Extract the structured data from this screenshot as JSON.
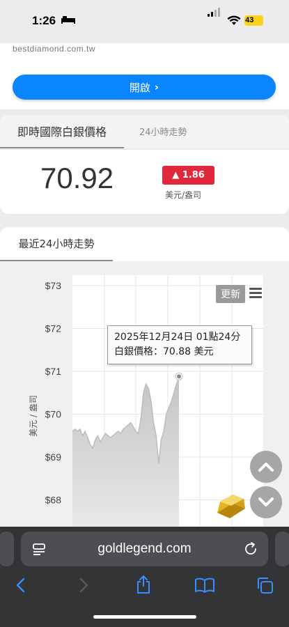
{
  "status_bar": {
    "time": "1:26",
    "battery": "43"
  },
  "ad": {
    "url_text": "bestdiamond.com.tw",
    "open_label": "開啟"
  },
  "tabs": {
    "realtime": "即時國際白銀價格",
    "trend": "24小時走勢"
  },
  "price": {
    "value": "70.92",
    "change": "▲ 1.86",
    "unit": "美元/盎司"
  },
  "trend_section": {
    "title": "最近24小時走勢",
    "refresh_label": "更新"
  },
  "tooltip": {
    "line1": "2025年12月24日 01點24分",
    "line2": "白銀價格：70.88 美元"
  },
  "browser": {
    "url": "goldlegend.com"
  },
  "colors": {
    "accent_blue": "#0a84ff",
    "change_red": "#e0283c",
    "area_gray": "#cfcfcf"
  },
  "chart_data": {
    "type": "area",
    "ylabel": "美元 / 盎司",
    "y_ticks": [
      "$73",
      "$72",
      "$71",
      "$70",
      "$69",
      "$68"
    ],
    "y_tick_values": [
      73,
      72,
      71,
      70,
      69,
      68
    ],
    "ylim": [
      67.5,
      73
    ],
    "grid": true,
    "series": [
      {
        "values": [
          69.6,
          69.65,
          69.6,
          69.65,
          69.5,
          69.6,
          69.45,
          69.3,
          69.2,
          69.4,
          69.5,
          69.35,
          69.45,
          69.55,
          69.5,
          69.45,
          69.5,
          69.55,
          69.6,
          69.55,
          69.65,
          69.7,
          69.75,
          69.8,
          69.7,
          69.6,
          69.55,
          69.9,
          70.5,
          70.7,
          70.6,
          70.3,
          69.8,
          69.5,
          68.85,
          69.4,
          69.6,
          70.0,
          70.15,
          70.3,
          70.5,
          70.7,
          70.88
        ]
      }
    ]
  }
}
